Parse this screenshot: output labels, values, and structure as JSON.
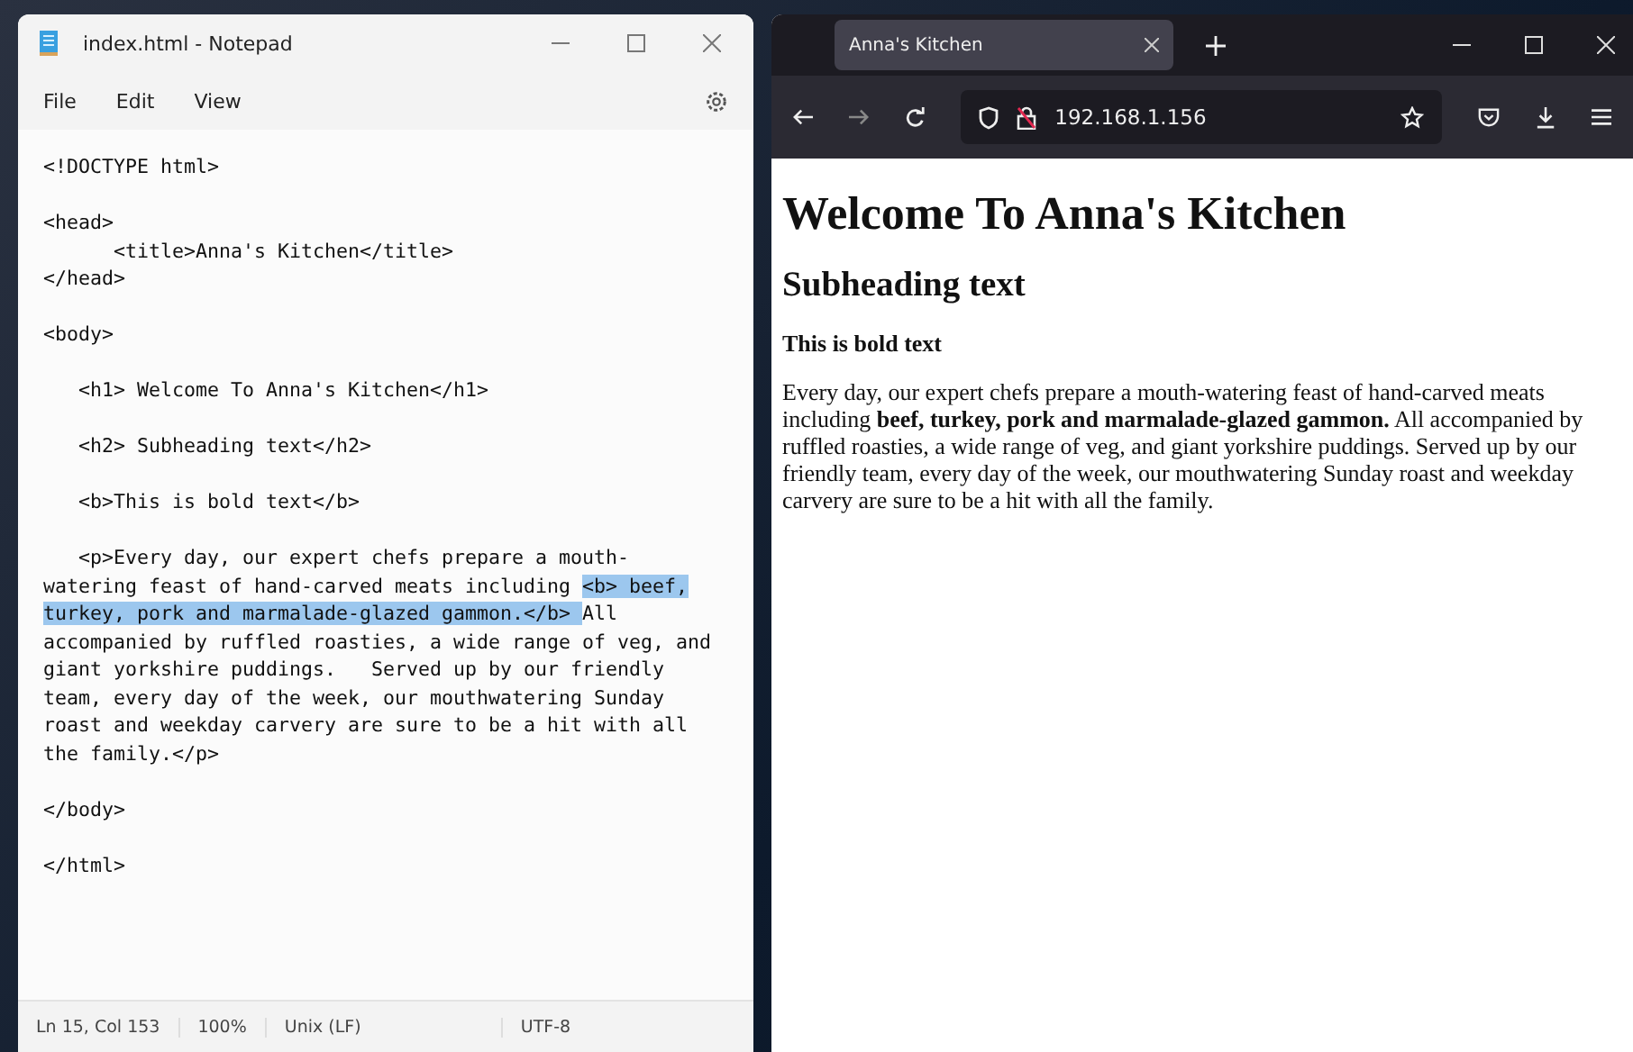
{
  "notepad": {
    "title": "index.html - Notepad",
    "menu": [
      "File",
      "Edit",
      "View"
    ],
    "code_blocks": [
      {
        "lines": [
          [
            {
              "text": "<!DOCTYPE html>",
              "selected": false
            }
          ]
        ]
      },
      {
        "lines": [
          [
            {
              "text": "<head>",
              "selected": false
            }
          ],
          [
            {
              "text": "      <title>Anna's Kitchen</title>",
              "selected": false
            }
          ],
          [
            {
              "text": "</head>",
              "selected": false
            }
          ]
        ]
      },
      {
        "lines": [
          [
            {
              "text": "<body>",
              "selected": false
            }
          ]
        ]
      },
      {
        "lines": [
          [
            {
              "text": "   <h1> Welcome To Anna's Kitchen</h1>",
              "selected": false
            }
          ]
        ]
      },
      {
        "lines": [
          [
            {
              "text": "   <h2> Subheading text</h2>",
              "selected": false
            }
          ]
        ]
      },
      {
        "lines": [
          [
            {
              "text": "   <b>This is bold text</b>",
              "selected": false
            }
          ]
        ]
      },
      {
        "lines": [
          [
            {
              "text": "   <p>Every day, our expert chefs prepare a mouth-",
              "selected": false
            }
          ],
          [
            {
              "text": "watering feast of hand-carved meats including ",
              "selected": false
            },
            {
              "text": "<b> beef,",
              "selected": true
            }
          ],
          [
            {
              "text": "turkey, pork and marmalade-glazed gammon.</b> ",
              "selected": true
            },
            {
              "text": "All",
              "selected": false
            }
          ],
          [
            {
              "text": "accompanied by ruffled roasties, a wide range of veg, and",
              "selected": false
            }
          ],
          [
            {
              "text": "giant yorkshire puddings.   Served up by our friendly",
              "selected": false
            }
          ],
          [
            {
              "text": "team, every day of the week, our mouthwatering Sunday",
              "selected": false
            }
          ],
          [
            {
              "text": "roast and weekday carvery are sure to be a hit with all",
              "selected": false
            }
          ],
          [
            {
              "text": "the family.</p>",
              "selected": false
            }
          ]
        ]
      },
      {
        "lines": [
          [
            {
              "text": "</body>",
              "selected": false
            }
          ]
        ]
      },
      {
        "lines": [
          [
            {
              "text": "</html>",
              "selected": false
            }
          ]
        ]
      }
    ],
    "status_bar": [
      "Ln 15, Col 153",
      "100%",
      "Unix (LF)",
      "UTF-8"
    ]
  },
  "browser": {
    "tabs": [
      {
        "label": "Anna's Kitchen",
        "selected": true
      }
    ],
    "address": "192.168.1.156",
    "page": {
      "h1": "Welcome To Anna's Kitchen",
      "h2": "Subheading text",
      "bold": "This is bold text",
      "paragraph": "Every day, our expert chefs prepare a mouth-watering feast of hand-carved meats including **beef, turkey, pork and marmalade-glazed gammon.** All accompanied by ruffled roasties, a wide range of veg, and giant yorkshire puddings. Served up by our friendly team, every day of the week, our mouthwatering Sunday roast and weekday carvery are sure to be a hit with all the family."
    }
  }
}
